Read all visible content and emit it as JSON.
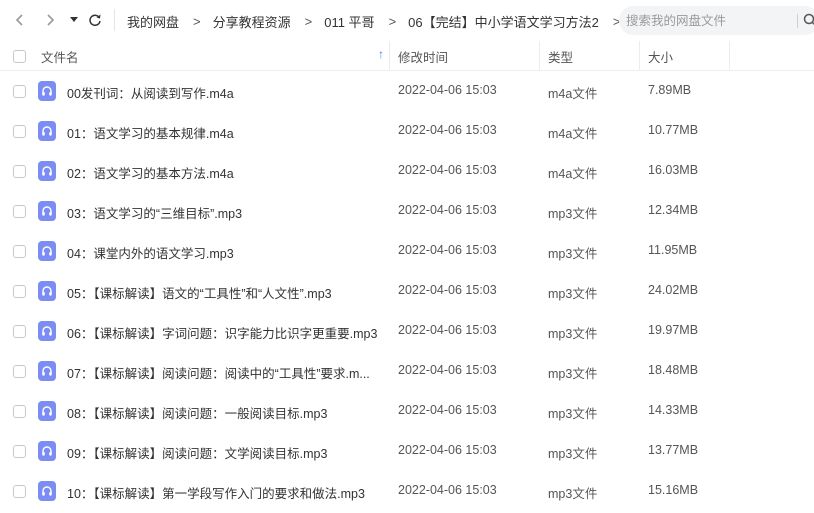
{
  "toolbar": {
    "breadcrumb": [
      "我的网盘",
      "分享教程资源",
      "011 平哥",
      "06【完结】中小学语文学习方法2"
    ],
    "separator": ">",
    "search_placeholder": "搜索我的网盘文件",
    "search_value": "",
    "icons": {
      "back": "chevron-left-icon",
      "forward": "chevron-right-icon",
      "history": "caret-down-icon",
      "refresh": "refresh-icon",
      "search": "search-icon"
    }
  },
  "header": {
    "name_col": "文件名",
    "sort_indicator": "↑",
    "sort_color": "#2f8cf0",
    "time_col": "修改时间",
    "type_col": "类型",
    "size_col": "大小"
  },
  "file_icon_color": "#7b8cf5",
  "files": [
    {
      "name": "00发刊词：从阅读到写作.m4a",
      "time": "2022-04-06 15:03",
      "type": "m4a文件",
      "size": "7.89MB"
    },
    {
      "name": "01：语文学习的基本规律.m4a",
      "time": "2022-04-06 15:03",
      "type": "m4a文件",
      "size": "10.77MB"
    },
    {
      "name": "02：语文学习的基本方法.m4a",
      "time": "2022-04-06 15:03",
      "type": "m4a文件",
      "size": "16.03MB"
    },
    {
      "name": "03：语文学习的“三维目标”.mp3",
      "time": "2022-04-06 15:03",
      "type": "mp3文件",
      "size": "12.34MB"
    },
    {
      "name": "04：课堂内外的语文学习.mp3",
      "time": "2022-04-06 15:03",
      "type": "mp3文件",
      "size": "11.95MB"
    },
    {
      "name": "05：【课标解读】语文的“工具性”和“人文性”.mp3",
      "time": "2022-04-06 15:03",
      "type": "mp3文件",
      "size": "24.02MB"
    },
    {
      "name": "06：【课标解读】字词问题：识字能力比识字更重要.mp3",
      "time": "2022-04-06 15:03",
      "type": "mp3文件",
      "size": "19.97MB"
    },
    {
      "name": "07：【课标解读】阅读问题：阅读中的“工具性”要求.m...",
      "time": "2022-04-06 15:03",
      "type": "mp3文件",
      "size": "18.48MB"
    },
    {
      "name": "08：【课标解读】阅读问题：一般阅读目标.mp3",
      "time": "2022-04-06 15:03",
      "type": "mp3文件",
      "size": "14.33MB"
    },
    {
      "name": "09：【课标解读】阅读问题：文学阅读目标.mp3",
      "time": "2022-04-06 15:03",
      "type": "mp3文件",
      "size": "13.77MB"
    },
    {
      "name": "10：【课标解读】第一学段写作入门的要求和做法.mp3",
      "time": "2022-04-06 15:03",
      "type": "mp3文件",
      "size": "15.16MB"
    }
  ]
}
